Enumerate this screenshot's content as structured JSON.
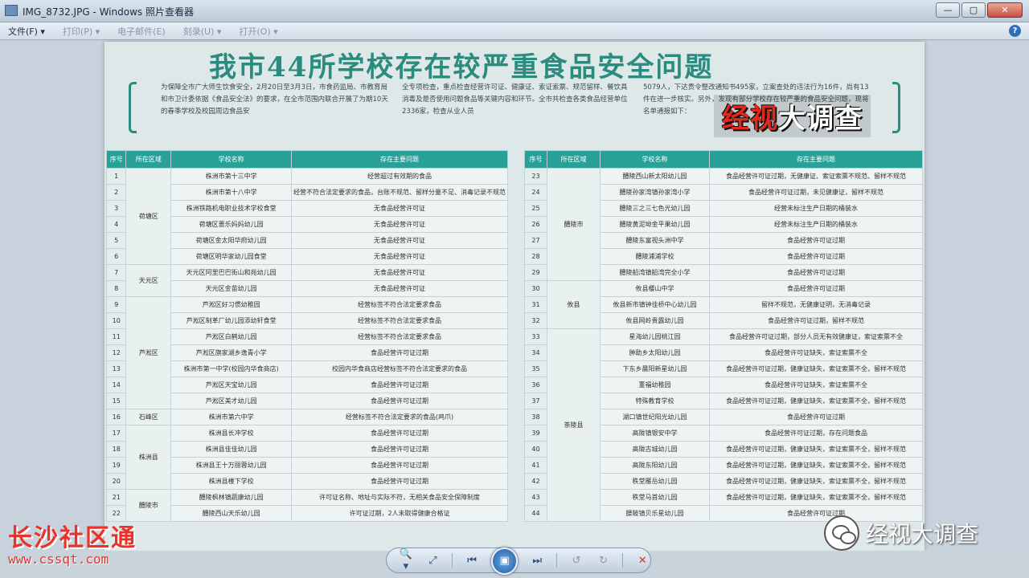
{
  "window": {
    "title": "IMG_8732.JPG - Windows 照片查看器",
    "buttons": [
      "—",
      "▢",
      "✕"
    ]
  },
  "menu": {
    "items": [
      {
        "label": "文件(F) ▾",
        "enabled": true
      },
      {
        "label": "打印(P) ▾",
        "enabled": false
      },
      {
        "label": "电子邮件(E)",
        "enabled": false
      },
      {
        "label": "刻录(U) ▾",
        "enabled": false
      },
      {
        "label": "打开(O) ▾",
        "enabled": false
      }
    ],
    "help": "?"
  },
  "photo": {
    "headline": "我市44所学校存在较严重食品安全问题",
    "intro_col1": "为保障全市广大师生饮食安全，2月20日至3月3日，市食药监局、市教育局和市卫计委依据《食品安全法》的要求，在全市范围内联合开展了为期10天的春季学校及校园周边食品安",
    "intro_col2": "全专项检查，重点检查经营许可证、健康证、索证索票、规范留样、餐饮具消毒及是否使用问题食品等关键内容和环节。全市共检查各类食品经营单位2336家，检查从业人员",
    "intro_col3": "5079人，下达责令整改通知书495家，立案查处的违法行为16件，尚有13件在进一步核实。另外，发现有部分学校存在较严重的食品安全问题，现将名单通报如下：",
    "table_headers": [
      "序号",
      "所在区域",
      "学校名称",
      "存在主要问题"
    ],
    "left_rows": [
      {
        "n": "1",
        "district": "荷塘区",
        "span": 6,
        "school": "株洲市第十三中学",
        "issue": "经营超过有效期的食品"
      },
      {
        "n": "2",
        "school": "株洲市第十八中学",
        "issue": "经营不符合法定要求的食品，台账不规范、留样分量不足、消毒记录不规范"
      },
      {
        "n": "3",
        "school": "株洲铁路机电职业技术学校食堂",
        "issue": "无食品经营许可证"
      },
      {
        "n": "4",
        "school": "荷塘区蔷乐妈妈幼儿园",
        "issue": "无食品经营许可证"
      },
      {
        "n": "5",
        "school": "荷塘区金太阳华府幼儿园",
        "issue": "无食品经营许可证"
      },
      {
        "n": "6",
        "school": "荷塘区明华家幼儿园食堂",
        "issue": "无食品经营许可证"
      },
      {
        "n": "7",
        "district": "天元区",
        "span": 2,
        "school": "天元区阿里巴巴街山和苑幼儿园",
        "issue": "无食品经营许可证"
      },
      {
        "n": "8",
        "school": "天元区金苗幼儿园",
        "issue": "无食品经营许可证"
      },
      {
        "n": "9",
        "district": "芦淞区",
        "span": 7,
        "school": "芦淞区好习惯幼稚园",
        "issue": "经营标签不符合法定要求食品"
      },
      {
        "n": "10",
        "school": "芦淞区制革厂幼儿园添幼轩食堂",
        "issue": "经营标签不符合法定要求食品"
      },
      {
        "n": "11",
        "school": "芦淞区白鹤幼儿园",
        "issue": "经营标签不符合法定要求食品"
      },
      {
        "n": "12",
        "school": "芦淞区旗家湖乡逸青小学",
        "issue": "食品经营许可证过期"
      },
      {
        "n": "13",
        "school": "株洲市第一中学(校园内华食商店)",
        "issue": "校园内华食商店经营标签不符合法定要求的食品"
      },
      {
        "n": "14",
        "school": "芦淞区天宝幼儿园",
        "issue": "食品经营许可证过期"
      },
      {
        "n": "15",
        "school": "芦淞区美才幼儿园",
        "issue": "食品经营许可证过期"
      },
      {
        "n": "16",
        "district": "石峰区",
        "span": 1,
        "school": "株洲市第六中学",
        "issue": "经营标签不符合法定要求的食品(鸡爪)"
      },
      {
        "n": "17",
        "district": "株洲县",
        "span": 4,
        "school": "株洲县长冲学校",
        "issue": "食品经营许可证过期"
      },
      {
        "n": "18",
        "school": "株洲县佳佳幼儿园",
        "issue": "食品经营许可证过期"
      },
      {
        "n": "19",
        "school": "株洲县王十万丽蓉幼儿园",
        "issue": "食品经营许可证过期"
      },
      {
        "n": "20",
        "school": "株洲县楼下学校",
        "issue": "食品经营许可证过期"
      },
      {
        "n": "21",
        "district": "醴陵市",
        "span": 2,
        "school": "醴陵枫林镇蔬康幼儿园",
        "issue": "许可证名称、地址与实际不符，无相关食品安全保障制度"
      },
      {
        "n": "22",
        "school": "醴陵西山天乐幼儿园",
        "issue": "许可证过期，2人未取得健康合格证"
      }
    ],
    "right_rows": [
      {
        "n": "23",
        "district": "醴陵市",
        "span": 7,
        "school": "醴陵西山新太阳幼儿园",
        "issue": "食品经营许可证过期，无健康证、索证索票不规范、留样不规范"
      },
      {
        "n": "24",
        "school": "醴陵孙家湾镇孙家湾小学",
        "issue": "食品经营许可证过期，未见健康证，留样不规范"
      },
      {
        "n": "25",
        "school": "醴陵三之三七色光幼儿园",
        "issue": "经营未标注生产日期的桶装水"
      },
      {
        "n": "26",
        "school": "醴陵黄泥坳金平果幼儿园",
        "issue": "经营未标注生产日期的桶装水"
      },
      {
        "n": "27",
        "school": "醴陵东富视头洲中学",
        "issue": "食品经营许可证过期"
      },
      {
        "n": "28",
        "school": "醴陵浦浦学校",
        "issue": "食品经营许可证过期"
      },
      {
        "n": "29",
        "school": "醴陵船湾镇船湾完全小学",
        "issue": "食品经营许可证过期"
      },
      {
        "n": "30",
        "district": "攸县",
        "span": 3,
        "school": "攸县樱山中学",
        "issue": "食品经营许可证过期"
      },
      {
        "n": "31",
        "school": "攸县新市镇钟佳桥中心幼儿园",
        "issue": "留样不规范，无健康证明，无消毒记录"
      },
      {
        "n": "32",
        "school": "攸县网岭贵露幼儿园",
        "issue": "食品经营许可证过期，留样不规范"
      },
      {
        "n": "33",
        "district": "茶陵县",
        "span": 12,
        "school": "星海幼儿园桃江园",
        "issue": "食品经营许可证过期，部分人员无有效健康证，索证索票不全"
      },
      {
        "n": "34",
        "school": "肿助乡太阳幼儿园",
        "issue": "食品经营许可证缺失，索证索票不全"
      },
      {
        "n": "35",
        "school": "下东乡晨阳新星幼儿园",
        "issue": "食品经营许可证过期，健康证缺失，索证索票不全，留样不规范"
      },
      {
        "n": "36",
        "school": "董福幼稚园",
        "issue": "食品经营许可证缺失，索证索票不全"
      },
      {
        "n": "37",
        "school": "特殊教育学校",
        "issue": "食品经营许可证过期，健康证缺失，索证索票不全，留样不规范"
      },
      {
        "n": "38",
        "school": "湖口镇世纪阳光幼儿园",
        "issue": "食品经营许可证过期"
      },
      {
        "n": "39",
        "school": "高陇镇银安中学",
        "issue": "食品经营许可证过期，存在问题食品"
      },
      {
        "n": "40",
        "school": "高陇古城幼儿园",
        "issue": "食品经营许可证过期，健康证缺失，索证索票不全，留样不规范"
      },
      {
        "n": "41",
        "school": "高陇东阳幼儿园",
        "issue": "食品经营许可证过期，健康证缺失，索证索票不全，留样不规范"
      },
      {
        "n": "42",
        "school": "秩堂雁岳幼儿园",
        "issue": "食品经营许可证过期，健康证缺失，索证索票不全，留样不规范"
      },
      {
        "n": "43",
        "school": "秩堂马首幼儿园",
        "issue": "食品经营许可证过期，健康证缺失，索证索票不全，留样不规范"
      },
      {
        "n": "44",
        "school": "腰陂镇贝乐星幼儿园",
        "issue": "食品经营许可证过期"
      }
    ]
  },
  "overlays": {
    "brand_red": "经视",
    "brand_white": "大调查",
    "watermark_cn": "长沙社区通",
    "watermark_url": "www.cssqt.com",
    "wechat_account": "经视大调查"
  },
  "toolbar": {
    "zoom": "🔍▾",
    "fit": "⤢",
    "prev": "⏮",
    "slideshow": "▣",
    "next": "⏭",
    "rotate_ccw": "↺",
    "rotate_cw": "↻",
    "delete": "✕"
  },
  "colors": {
    "accent": "#2aa198",
    "headline": "#2a8c7e",
    "watermark": "#e8322a"
  }
}
